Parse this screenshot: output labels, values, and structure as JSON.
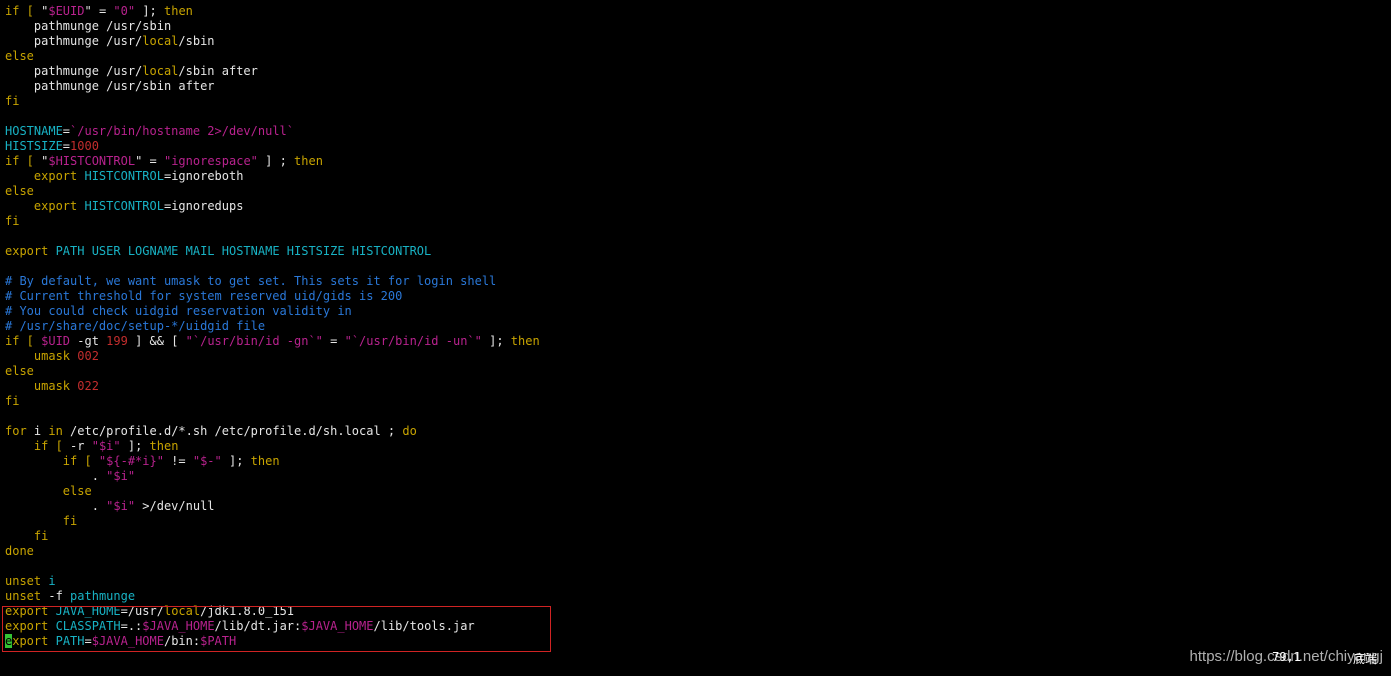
{
  "editor": {
    "lines": [
      {
        "segments": [
          {
            "t": "if [ ",
            "c": "k"
          },
          {
            "t": "\"",
            "c": "w"
          },
          {
            "t": "$EUID",
            "c": "s"
          },
          {
            "t": "\"",
            "c": "w"
          },
          {
            "t": " = ",
            "c": "w"
          },
          {
            "t": "\"0\"",
            "c": "s"
          },
          {
            "t": " ]; ",
            "c": "w"
          },
          {
            "t": "then",
            "c": "k"
          }
        ]
      },
      {
        "segments": [
          {
            "t": "    pathmunge /usr/sbin",
            "c": "w"
          }
        ]
      },
      {
        "segments": [
          {
            "t": "    pathmunge /usr/",
            "c": "w"
          },
          {
            "t": "local",
            "c": "k"
          },
          {
            "t": "/sbin",
            "c": "w"
          }
        ]
      },
      {
        "segments": [
          {
            "t": "else",
            "c": "k"
          }
        ]
      },
      {
        "segments": [
          {
            "t": "    pathmunge /usr/",
            "c": "w"
          },
          {
            "t": "local",
            "c": "k"
          },
          {
            "t": "/sbin after",
            "c": "w"
          }
        ]
      },
      {
        "segments": [
          {
            "t": "    pathmunge /usr/sbin after",
            "c": "w"
          }
        ]
      },
      {
        "segments": [
          {
            "t": "fi",
            "c": "k"
          }
        ]
      },
      {
        "segments": [
          {
            "t": "",
            "c": "w"
          }
        ]
      },
      {
        "segments": [
          {
            "t": "HOSTNAME",
            "c": "v"
          },
          {
            "t": "=",
            "c": "w"
          },
          {
            "t": "`/usr/bin/hostname 2>/dev/null`",
            "c": "s"
          }
        ]
      },
      {
        "segments": [
          {
            "t": "HISTSIZE",
            "c": "v"
          },
          {
            "t": "=",
            "c": "w"
          },
          {
            "t": "1000",
            "c": "n"
          }
        ]
      },
      {
        "segments": [
          {
            "t": "if [ ",
            "c": "k"
          },
          {
            "t": "\"",
            "c": "w"
          },
          {
            "t": "$HISTCONTROL",
            "c": "s"
          },
          {
            "t": "\"",
            "c": "w"
          },
          {
            "t": " = ",
            "c": "w"
          },
          {
            "t": "\"ignorespace\"",
            "c": "s"
          },
          {
            "t": " ] ; ",
            "c": "w"
          },
          {
            "t": "then",
            "c": "k"
          }
        ]
      },
      {
        "segments": [
          {
            "t": "    export ",
            "c": "k"
          },
          {
            "t": "HISTCONTROL",
            "c": "v"
          },
          {
            "t": "=ignoreboth",
            "c": "w"
          }
        ]
      },
      {
        "segments": [
          {
            "t": "else",
            "c": "k"
          }
        ]
      },
      {
        "segments": [
          {
            "t": "    export ",
            "c": "k"
          },
          {
            "t": "HISTCONTROL",
            "c": "v"
          },
          {
            "t": "=ignoredups",
            "c": "w"
          }
        ]
      },
      {
        "segments": [
          {
            "t": "fi",
            "c": "k"
          }
        ]
      },
      {
        "segments": [
          {
            "t": "",
            "c": "w"
          }
        ]
      },
      {
        "segments": [
          {
            "t": "export ",
            "c": "k"
          },
          {
            "t": "PATH USER LOGNAME MAIL HOSTNAME HISTSIZE HISTCONTROL",
            "c": "v"
          }
        ]
      },
      {
        "segments": [
          {
            "t": "",
            "c": "w"
          }
        ]
      },
      {
        "segments": [
          {
            "t": "# By default, we want umask to get set. This sets it for login shell",
            "c": "c"
          }
        ]
      },
      {
        "segments": [
          {
            "t": "# Current threshold for system reserved uid/gids is 200",
            "c": "c"
          }
        ]
      },
      {
        "segments": [
          {
            "t": "# You could check uidgid reservation validity in",
            "c": "c"
          }
        ]
      },
      {
        "segments": [
          {
            "t": "# /usr/share/doc/setup-*/uidgid file",
            "c": "c"
          }
        ]
      },
      {
        "segments": [
          {
            "t": "if [ ",
            "c": "k"
          },
          {
            "t": "$UID",
            "c": "s"
          },
          {
            "t": " -gt ",
            "c": "w"
          },
          {
            "t": "199",
            "c": "n"
          },
          {
            "t": " ] && [ ",
            "c": "w"
          },
          {
            "t": "\"`/usr/bin/id -gn`\"",
            "c": "s"
          },
          {
            "t": " = ",
            "c": "w"
          },
          {
            "t": "\"`/usr/bin/id -un`\"",
            "c": "s"
          },
          {
            "t": " ]; ",
            "c": "w"
          },
          {
            "t": "then",
            "c": "k"
          }
        ]
      },
      {
        "segments": [
          {
            "t": "    umask ",
            "c": "k"
          },
          {
            "t": "002",
            "c": "n"
          }
        ]
      },
      {
        "segments": [
          {
            "t": "else",
            "c": "k"
          }
        ]
      },
      {
        "segments": [
          {
            "t": "    umask ",
            "c": "k"
          },
          {
            "t": "022",
            "c": "n"
          }
        ]
      },
      {
        "segments": [
          {
            "t": "fi",
            "c": "k"
          }
        ]
      },
      {
        "segments": [
          {
            "t": "",
            "c": "w"
          }
        ]
      },
      {
        "segments": [
          {
            "t": "for ",
            "c": "k"
          },
          {
            "t": "i ",
            "c": "w"
          },
          {
            "t": "in ",
            "c": "k"
          },
          {
            "t": "/etc/profile.d/*.sh /etc/profile.d/sh.local ; ",
            "c": "w"
          },
          {
            "t": "do",
            "c": "k"
          }
        ]
      },
      {
        "segments": [
          {
            "t": "    if [ ",
            "c": "k"
          },
          {
            "t": "-r ",
            "c": "w"
          },
          {
            "t": "\"$i\"",
            "c": "s"
          },
          {
            "t": " ]; ",
            "c": "w"
          },
          {
            "t": "then",
            "c": "k"
          }
        ]
      },
      {
        "segments": [
          {
            "t": "        if [ ",
            "c": "k"
          },
          {
            "t": "\"${-#*i}\"",
            "c": "s"
          },
          {
            "t": " != ",
            "c": "w"
          },
          {
            "t": "\"$-\"",
            "c": "s"
          },
          {
            "t": " ]; ",
            "c": "w"
          },
          {
            "t": "then",
            "c": "k"
          }
        ]
      },
      {
        "segments": [
          {
            "t": "            . ",
            "c": "w"
          },
          {
            "t": "\"$i\"",
            "c": "s"
          }
        ]
      },
      {
        "segments": [
          {
            "t": "        else",
            "c": "k"
          }
        ]
      },
      {
        "segments": [
          {
            "t": "            . ",
            "c": "w"
          },
          {
            "t": "\"$i\"",
            "c": "s"
          },
          {
            "t": " >/dev/null",
            "c": "w"
          }
        ]
      },
      {
        "segments": [
          {
            "t": "        fi",
            "c": "k"
          }
        ]
      },
      {
        "segments": [
          {
            "t": "    fi",
            "c": "k"
          }
        ]
      },
      {
        "segments": [
          {
            "t": "done",
            "c": "k"
          }
        ]
      },
      {
        "segments": [
          {
            "t": "",
            "c": "w"
          }
        ]
      },
      {
        "segments": [
          {
            "t": "unset ",
            "c": "k"
          },
          {
            "t": "i",
            "c": "v"
          }
        ]
      },
      {
        "segments": [
          {
            "t": "unset ",
            "c": "k"
          },
          {
            "t": "-f ",
            "c": "w"
          },
          {
            "t": "pathmunge",
            "c": "v"
          }
        ]
      },
      {
        "segments": [
          {
            "t": "export ",
            "c": "k"
          },
          {
            "t": "JAVA_HOME",
            "c": "v"
          },
          {
            "t": "=/usr/",
            "c": "w"
          },
          {
            "t": "local",
            "c": "k"
          },
          {
            "t": "/jdk1.8.0_151",
            "c": "w"
          }
        ]
      },
      {
        "segments": [
          {
            "t": "export ",
            "c": "k"
          },
          {
            "t": "CLASSPATH",
            "c": "v"
          },
          {
            "t": "=.:",
            "c": "w"
          },
          {
            "t": "$JAVA_HOME",
            "c": "s"
          },
          {
            "t": "/lib/dt.jar:",
            "c": "w"
          },
          {
            "t": "$JAVA_HOME",
            "c": "s"
          },
          {
            "t": "/lib/tools.jar",
            "c": "w"
          }
        ]
      },
      {
        "segments": [
          {
            "t": "e",
            "c": "cursor"
          },
          {
            "t": "xport ",
            "c": "k"
          },
          {
            "t": "PATH",
            "c": "v"
          },
          {
            "t": "=",
            "c": "w"
          },
          {
            "t": "$JAVA_HOME",
            "c": "s"
          },
          {
            "t": "/bin:",
            "c": "w"
          },
          {
            "t": "$PATH",
            "c": "s"
          }
        ]
      }
    ]
  },
  "status": {
    "position": "79,1",
    "mode": "底端"
  },
  "watermark": {
    "text": "https://blog.csdn.net/chiyangj"
  },
  "colors": {
    "background": "#000000",
    "keyword": "#c8a400",
    "identifier": "#18b2c4",
    "string": "#b8228e",
    "number": "#c22d2d",
    "comment": "#2a78d8",
    "highlight_border": "#d02323",
    "cursor": "#34c334"
  }
}
